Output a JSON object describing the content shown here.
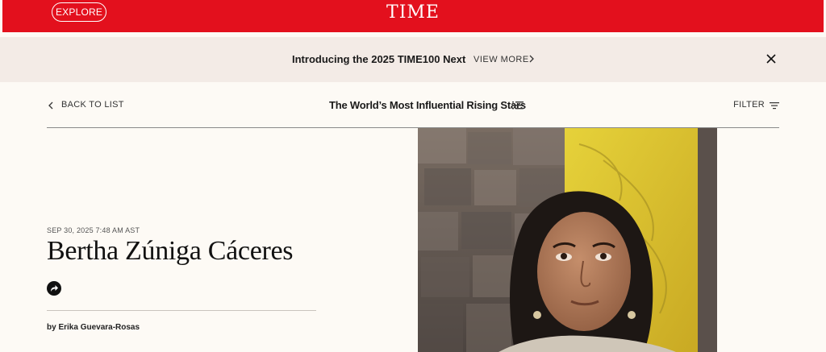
{
  "header": {
    "explore_label": "EXPLORE",
    "logo": "TIME",
    "brand_color": "#e3101d"
  },
  "promo": {
    "text": "Introducing the 2025 TIME100 Next",
    "link_label": "VIEW MORE",
    "chevron_icon": "chevron-right-icon",
    "close_icon": "close-icon"
  },
  "subnav": {
    "back_label": "BACK TO LIST",
    "list_title": "The World’s Most Influential Rising Stars",
    "list_icon": "list-icon",
    "filter_label": "FILTER",
    "filter_icon": "filter-icon"
  },
  "article": {
    "date": "SEP 30, 2025 7:48 AM AST",
    "title": "Bertha Zúniga Cáceres",
    "share_icon": "share-arrow-icon",
    "byline": "by Erika Guevara-Rosas"
  }
}
